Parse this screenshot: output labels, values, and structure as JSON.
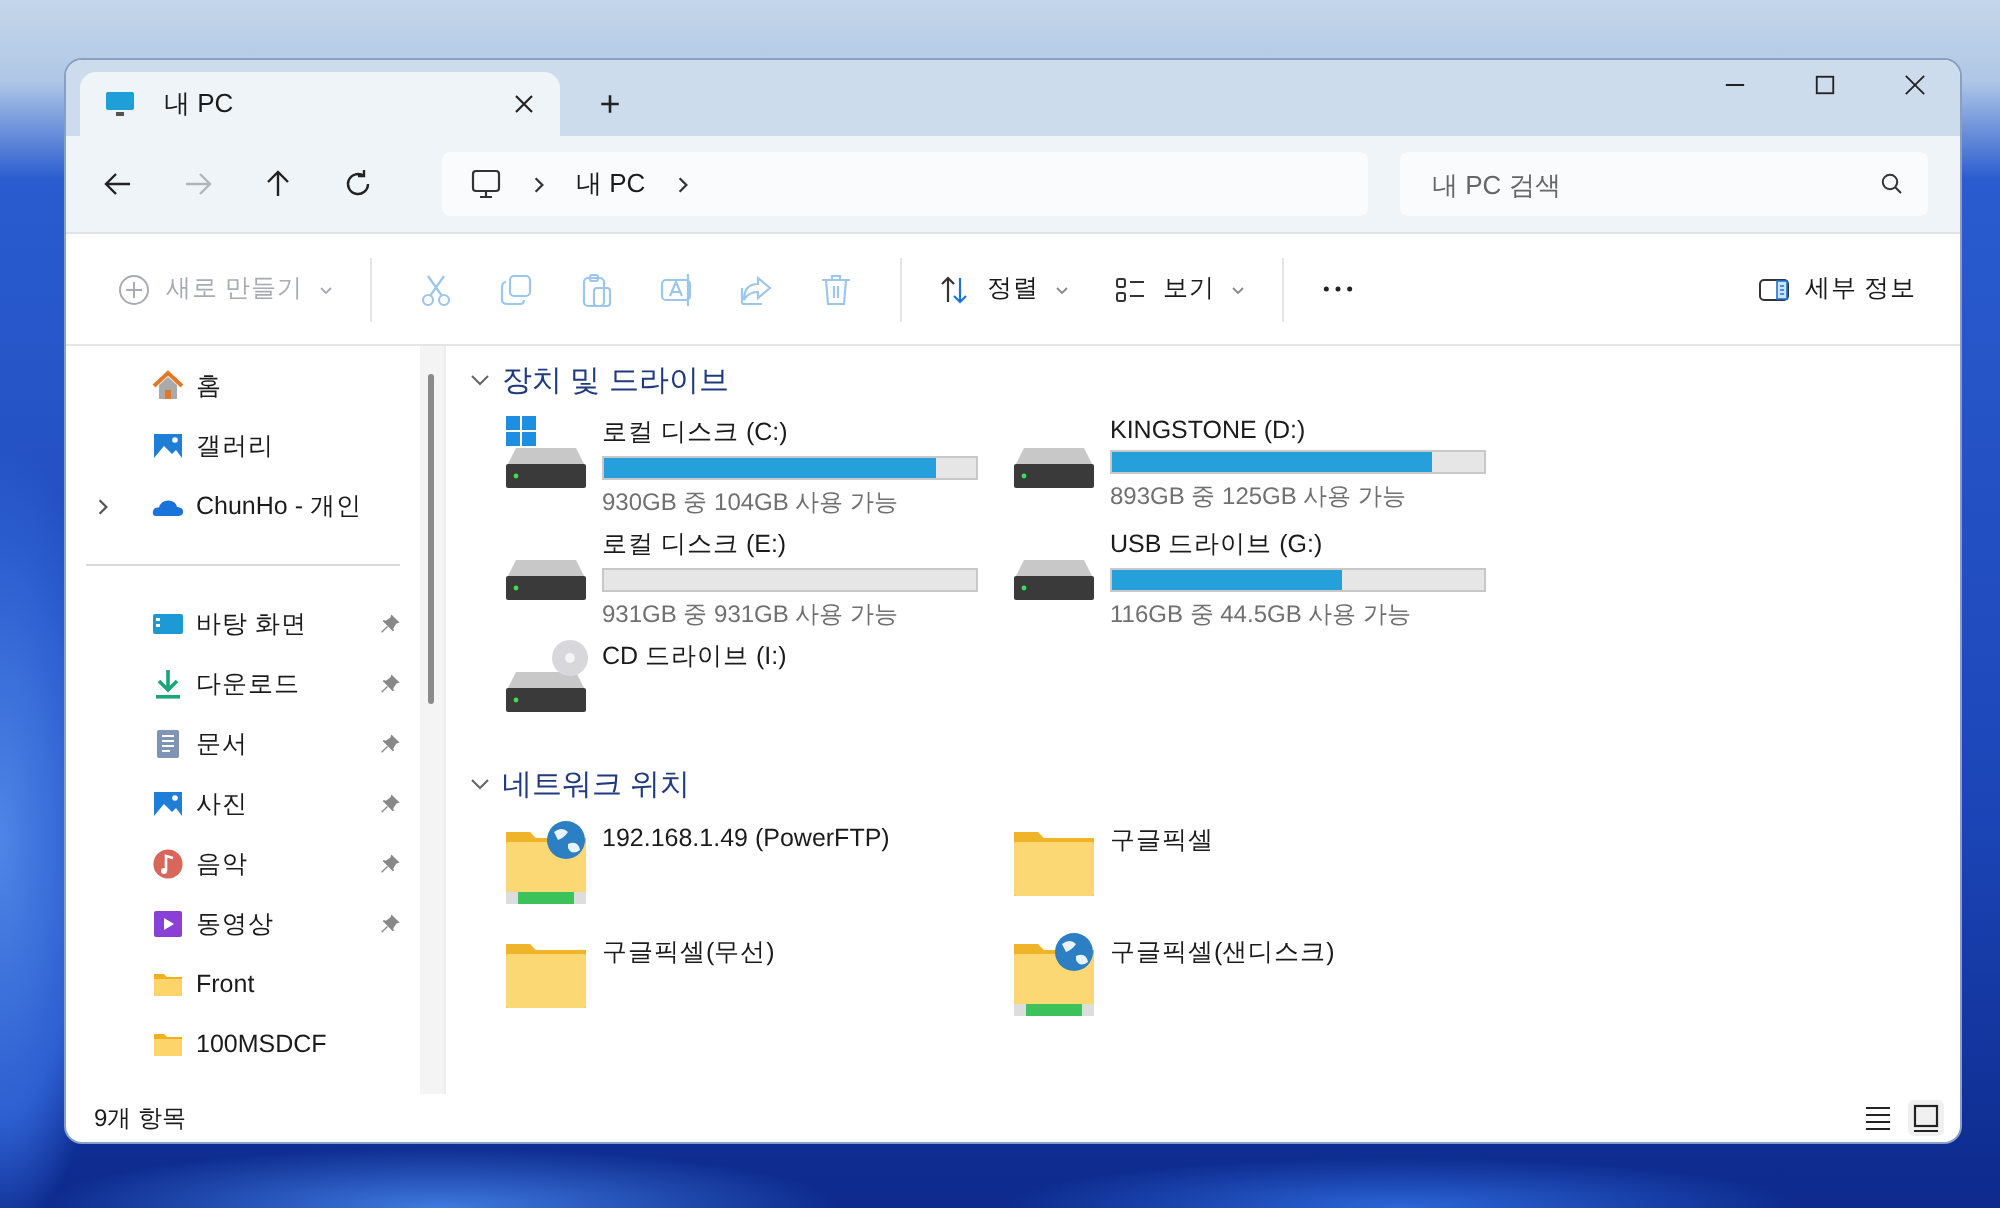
{
  "window": {
    "tabs": [
      {
        "label": "내 PC",
        "selected": true
      }
    ],
    "new_tab": "+"
  },
  "nav": [
    {
      "kind": "back",
      "disabled": false
    },
    {
      "kind": "forward",
      "disabled": true
    },
    {
      "kind": "up",
      "disabled": false
    },
    {
      "kind": "refresh",
      "disabled": false
    }
  ],
  "breadcrumb": [
    "내 PC"
  ],
  "search": {
    "placeholder": "내 PC 검색"
  },
  "toolbar": {
    "new": {
      "label": "새로 만들기",
      "disabled": true
    },
    "actions": [
      {
        "kind": "cut",
        "disabled": true
      },
      {
        "kind": "copy",
        "disabled": true
      },
      {
        "kind": "paste",
        "disabled": true
      },
      {
        "kind": "rename",
        "disabled": true
      },
      {
        "kind": "share",
        "disabled": true
      },
      {
        "kind": "delete",
        "disabled": true
      }
    ],
    "sort": {
      "label": "정렬"
    },
    "view": {
      "label": "보기"
    },
    "details": {
      "label": "세부 정보"
    }
  },
  "sidebar": {
    "top": [
      {
        "label": "홈",
        "kind": "home"
      },
      {
        "label": "갤러리",
        "kind": "gallery"
      },
      {
        "label": "ChunHo - 개인",
        "kind": "cloud",
        "expanded": false
      }
    ],
    "pinned": [
      {
        "label": "바탕 화면",
        "kind": "desktop",
        "pinned": true
      },
      {
        "label": "다운로드",
        "kind": "download",
        "pinned": true
      },
      {
        "label": "문서",
        "kind": "document",
        "pinned": true
      },
      {
        "label": "사진",
        "kind": "picture",
        "pinned": true
      },
      {
        "label": "음악",
        "kind": "music",
        "pinned": true
      },
      {
        "label": "동영상",
        "kind": "video",
        "pinned": true
      },
      {
        "label": "Front",
        "kind": "folder",
        "pinned": false
      },
      {
        "label": "100MSDCF",
        "kind": "folder",
        "pinned": false
      }
    ]
  },
  "sections": [
    {
      "title": "장치 및 드라이브",
      "expanded": true,
      "items": [
        {
          "kind": "drive",
          "name": "로컬 디스크 (C:)",
          "system": true,
          "level": 0.89,
          "reading": "930GB 중 104GB 사용 가능"
        },
        {
          "kind": "drive",
          "name": "KINGSTONE (D:)",
          "system": false,
          "level": 0.86,
          "reading": "893GB 중 125GB 사용 가능"
        },
        {
          "kind": "drive",
          "name": "로컬 디스크 (E:)",
          "system": false,
          "level": 0,
          "reading": "931GB 중 931GB 사용 가능"
        },
        {
          "kind": "drive",
          "name": "USB 드라이브 (G:)",
          "system": false,
          "level": 0.62,
          "reading": "116GB 중 44.5GB 사용 가능"
        },
        {
          "kind": "cd",
          "name": "CD 드라이브 (I:)"
        }
      ]
    },
    {
      "title": "네트워크 위치",
      "expanded": true,
      "items": [
        {
          "kind": "network",
          "name": "192.168.1.49 (PowerFTP)"
        },
        {
          "kind": "folder",
          "name": "구글픽셀"
        },
        {
          "kind": "folder",
          "name": "구글픽셀(무선)"
        },
        {
          "kind": "network",
          "name": "구글픽셀(샌디스크)"
        }
      ]
    }
  ],
  "status": {
    "count": "9개 항목"
  },
  "view_modes": [
    {
      "kind": "details",
      "selected": false
    },
    {
      "kind": "tiles",
      "selected": true
    }
  ]
}
